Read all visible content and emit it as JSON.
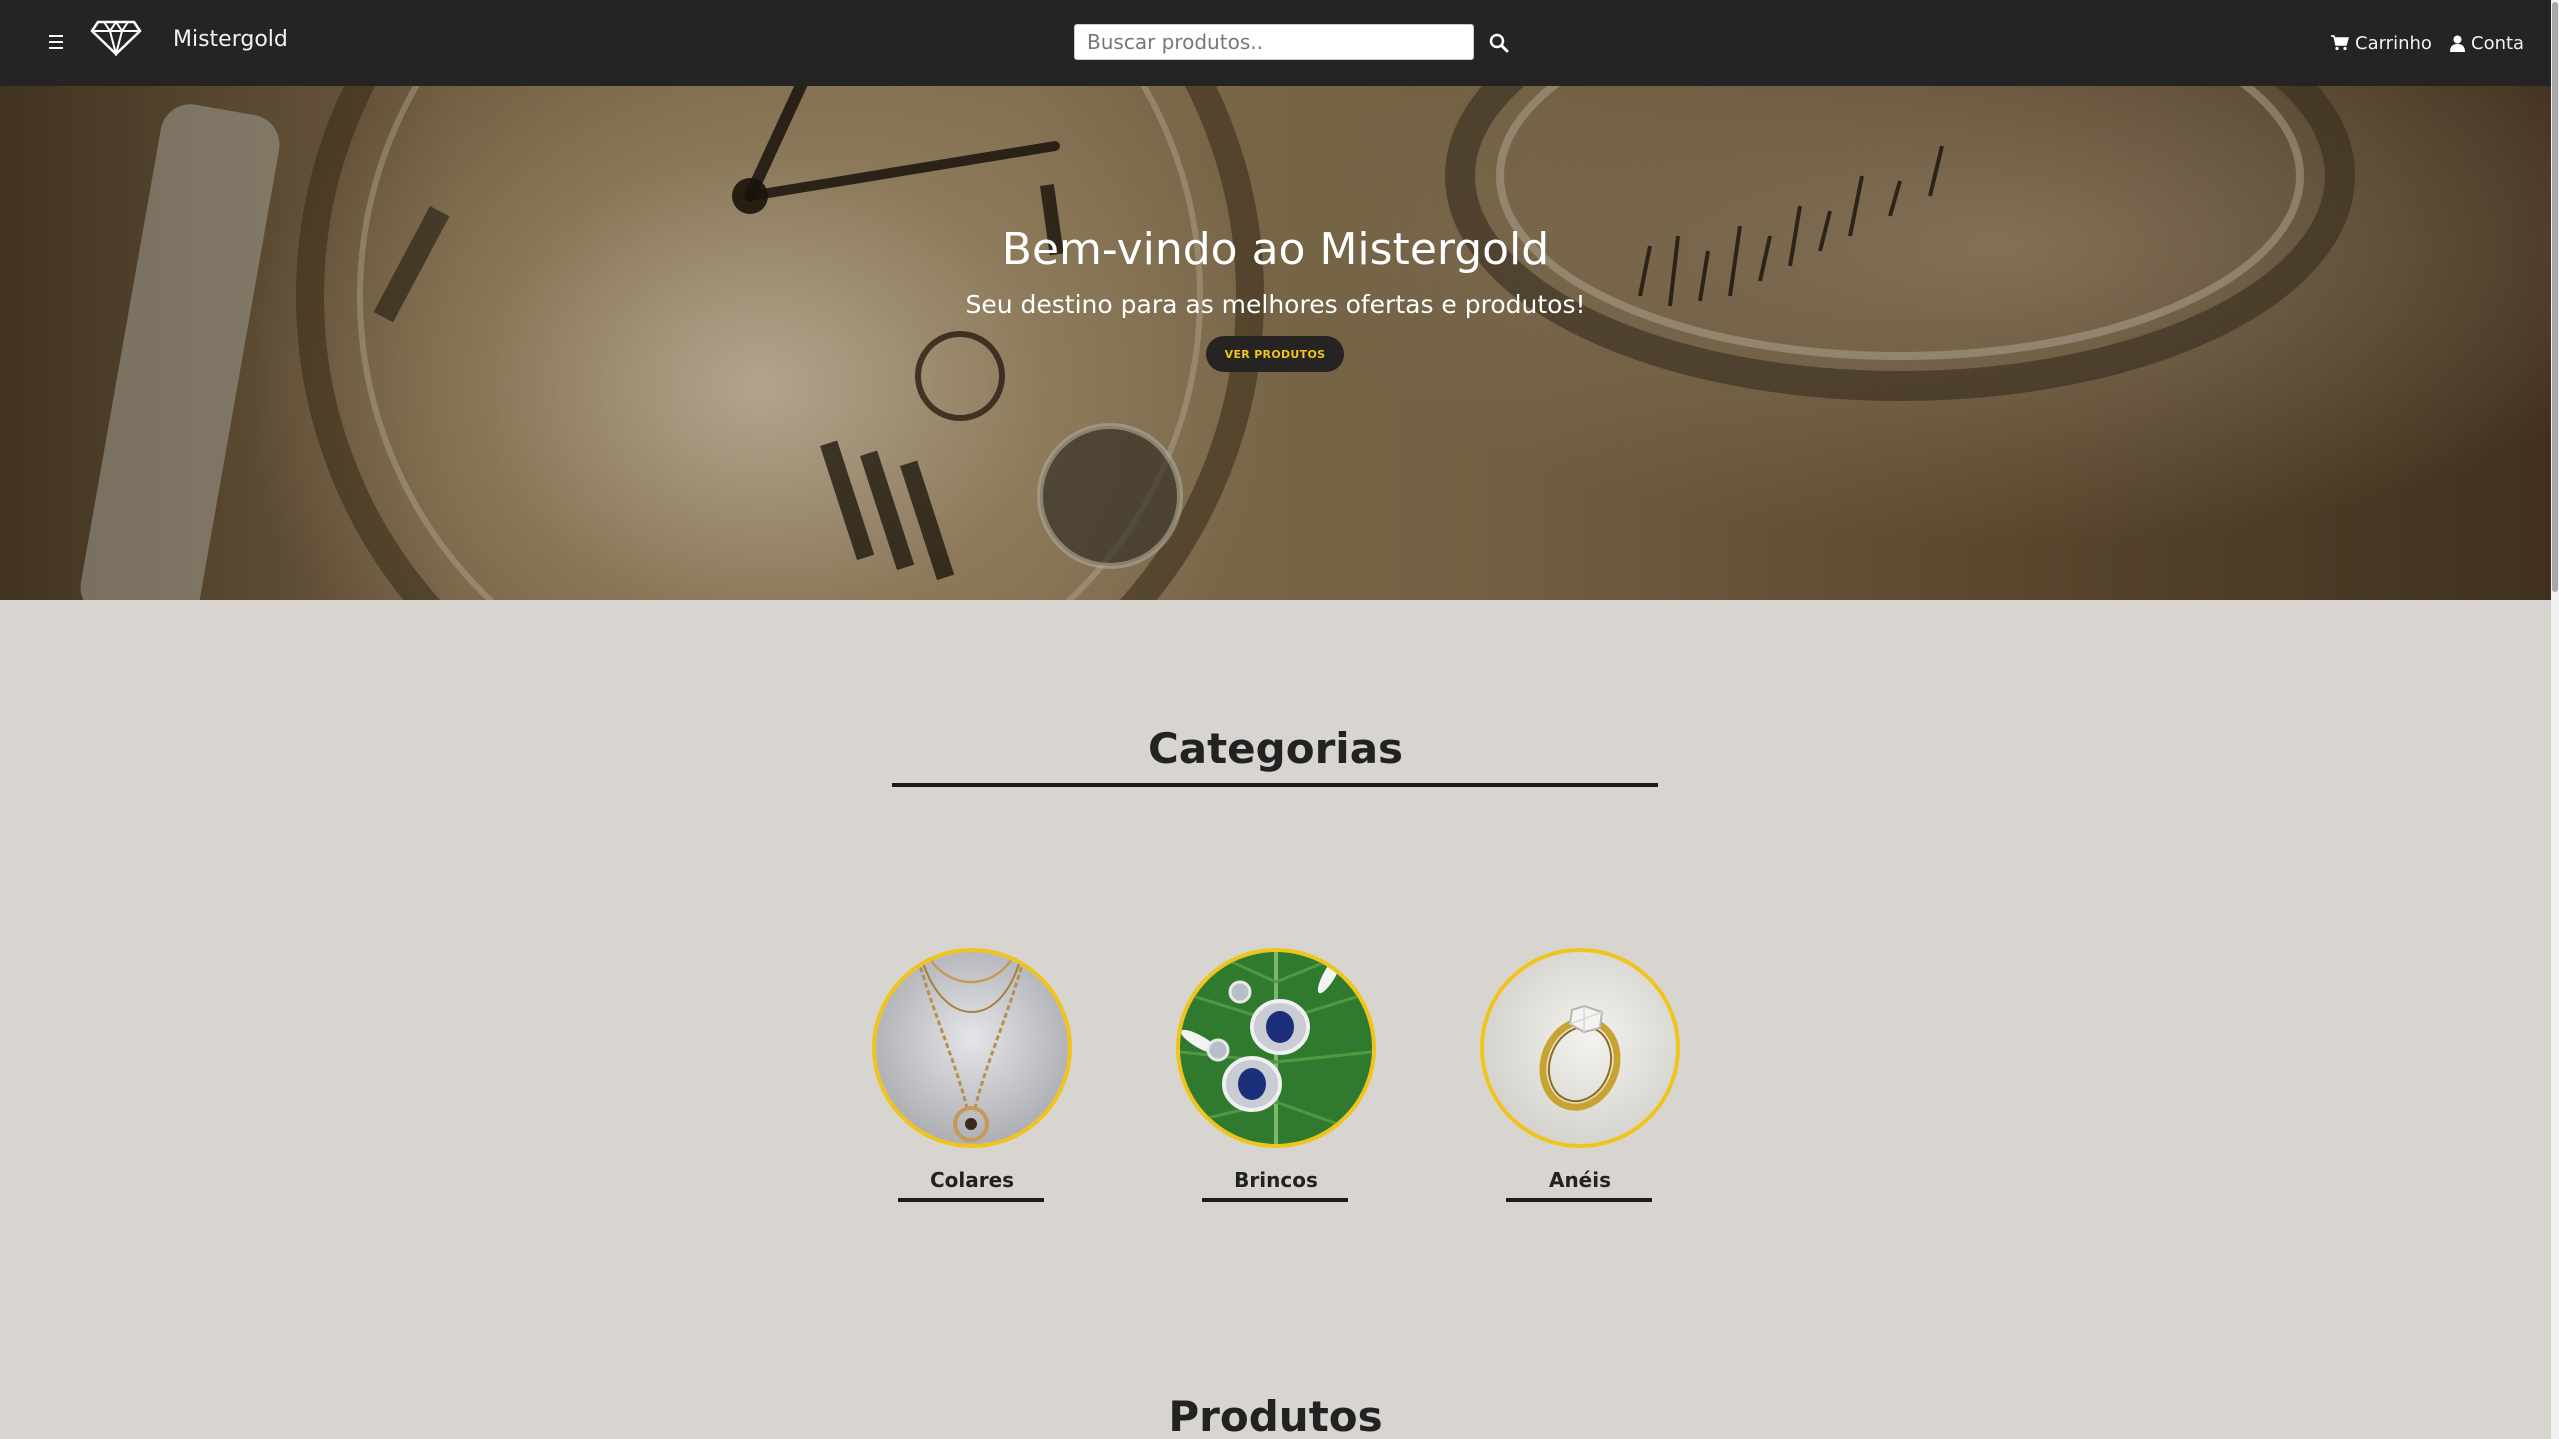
{
  "navbar": {
    "brand": "Mistergold",
    "search_placeholder": "Buscar produtos..",
    "cart_label": "Carrinho",
    "account_label": "Conta",
    "icons": [
      "menu-icon",
      "diamond-logo",
      "search-icon",
      "cart-icon",
      "user-icon"
    ]
  },
  "hero": {
    "title": "Bem-vindo ao Mistergold",
    "subtitle": "Seu destino para as melhores ofertas e produtos!",
    "button_label": "VER PRODUTOS"
  },
  "categories": {
    "title": "Categorias",
    "items": [
      {
        "label": "Colares"
      },
      {
        "label": "Brincos"
      },
      {
        "label": "Anéis"
      }
    ]
  },
  "products": {
    "title": "Produtos"
  },
  "colors": {
    "navbar_bg": "#262323",
    "accent_gold": "#f0c419",
    "page_bg": "#d8d4d0"
  }
}
